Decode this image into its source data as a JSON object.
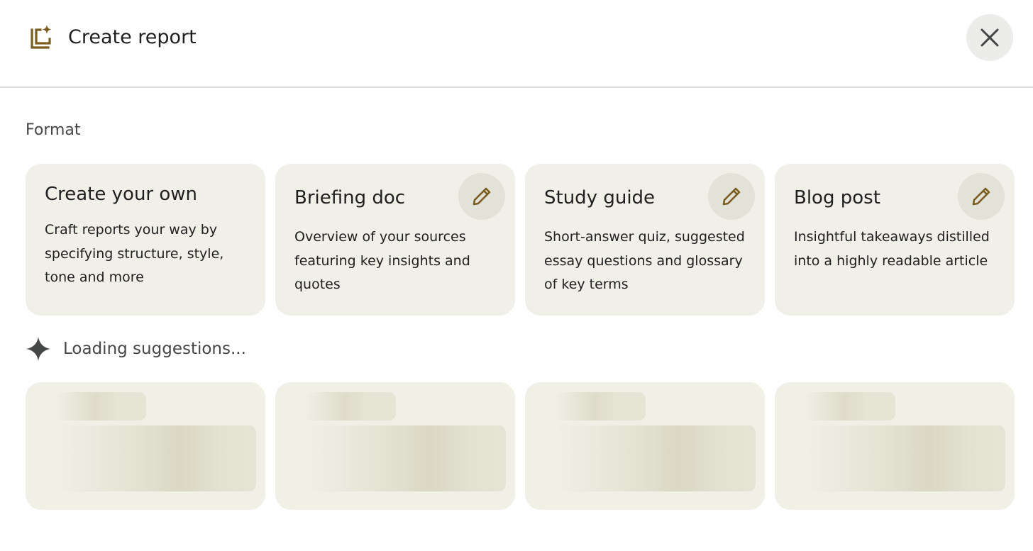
{
  "header": {
    "title": "Create report",
    "icon": "report-sparkle-icon",
    "close_icon": "close-icon"
  },
  "format": {
    "label": "Format",
    "cards": [
      {
        "title": "Create your own",
        "description": "Craft reports your way by specifying structure, style, tone and more",
        "editable": false
      },
      {
        "title": "Briefing doc",
        "description": "Overview of your sources featuring key insights and quotes",
        "editable": true,
        "edit_icon": "pencil-icon"
      },
      {
        "title": "Study guide",
        "description": "Short-answer quiz, suggested essay questions and glossary of key terms",
        "editable": true,
        "edit_icon": "pencil-icon"
      },
      {
        "title": "Blog post",
        "description": "Insightful takeaways distilled into a highly readable article",
        "editable": true,
        "edit_icon": "pencil-icon"
      }
    ]
  },
  "suggestions": {
    "loading_text": "Loading suggestions...",
    "icon": "sparkle-icon",
    "placeholder_count": 4
  },
  "colors": {
    "accent": "#7a5c1e",
    "card_bg": "#f0f0e8",
    "close_bg": "#ececea"
  }
}
